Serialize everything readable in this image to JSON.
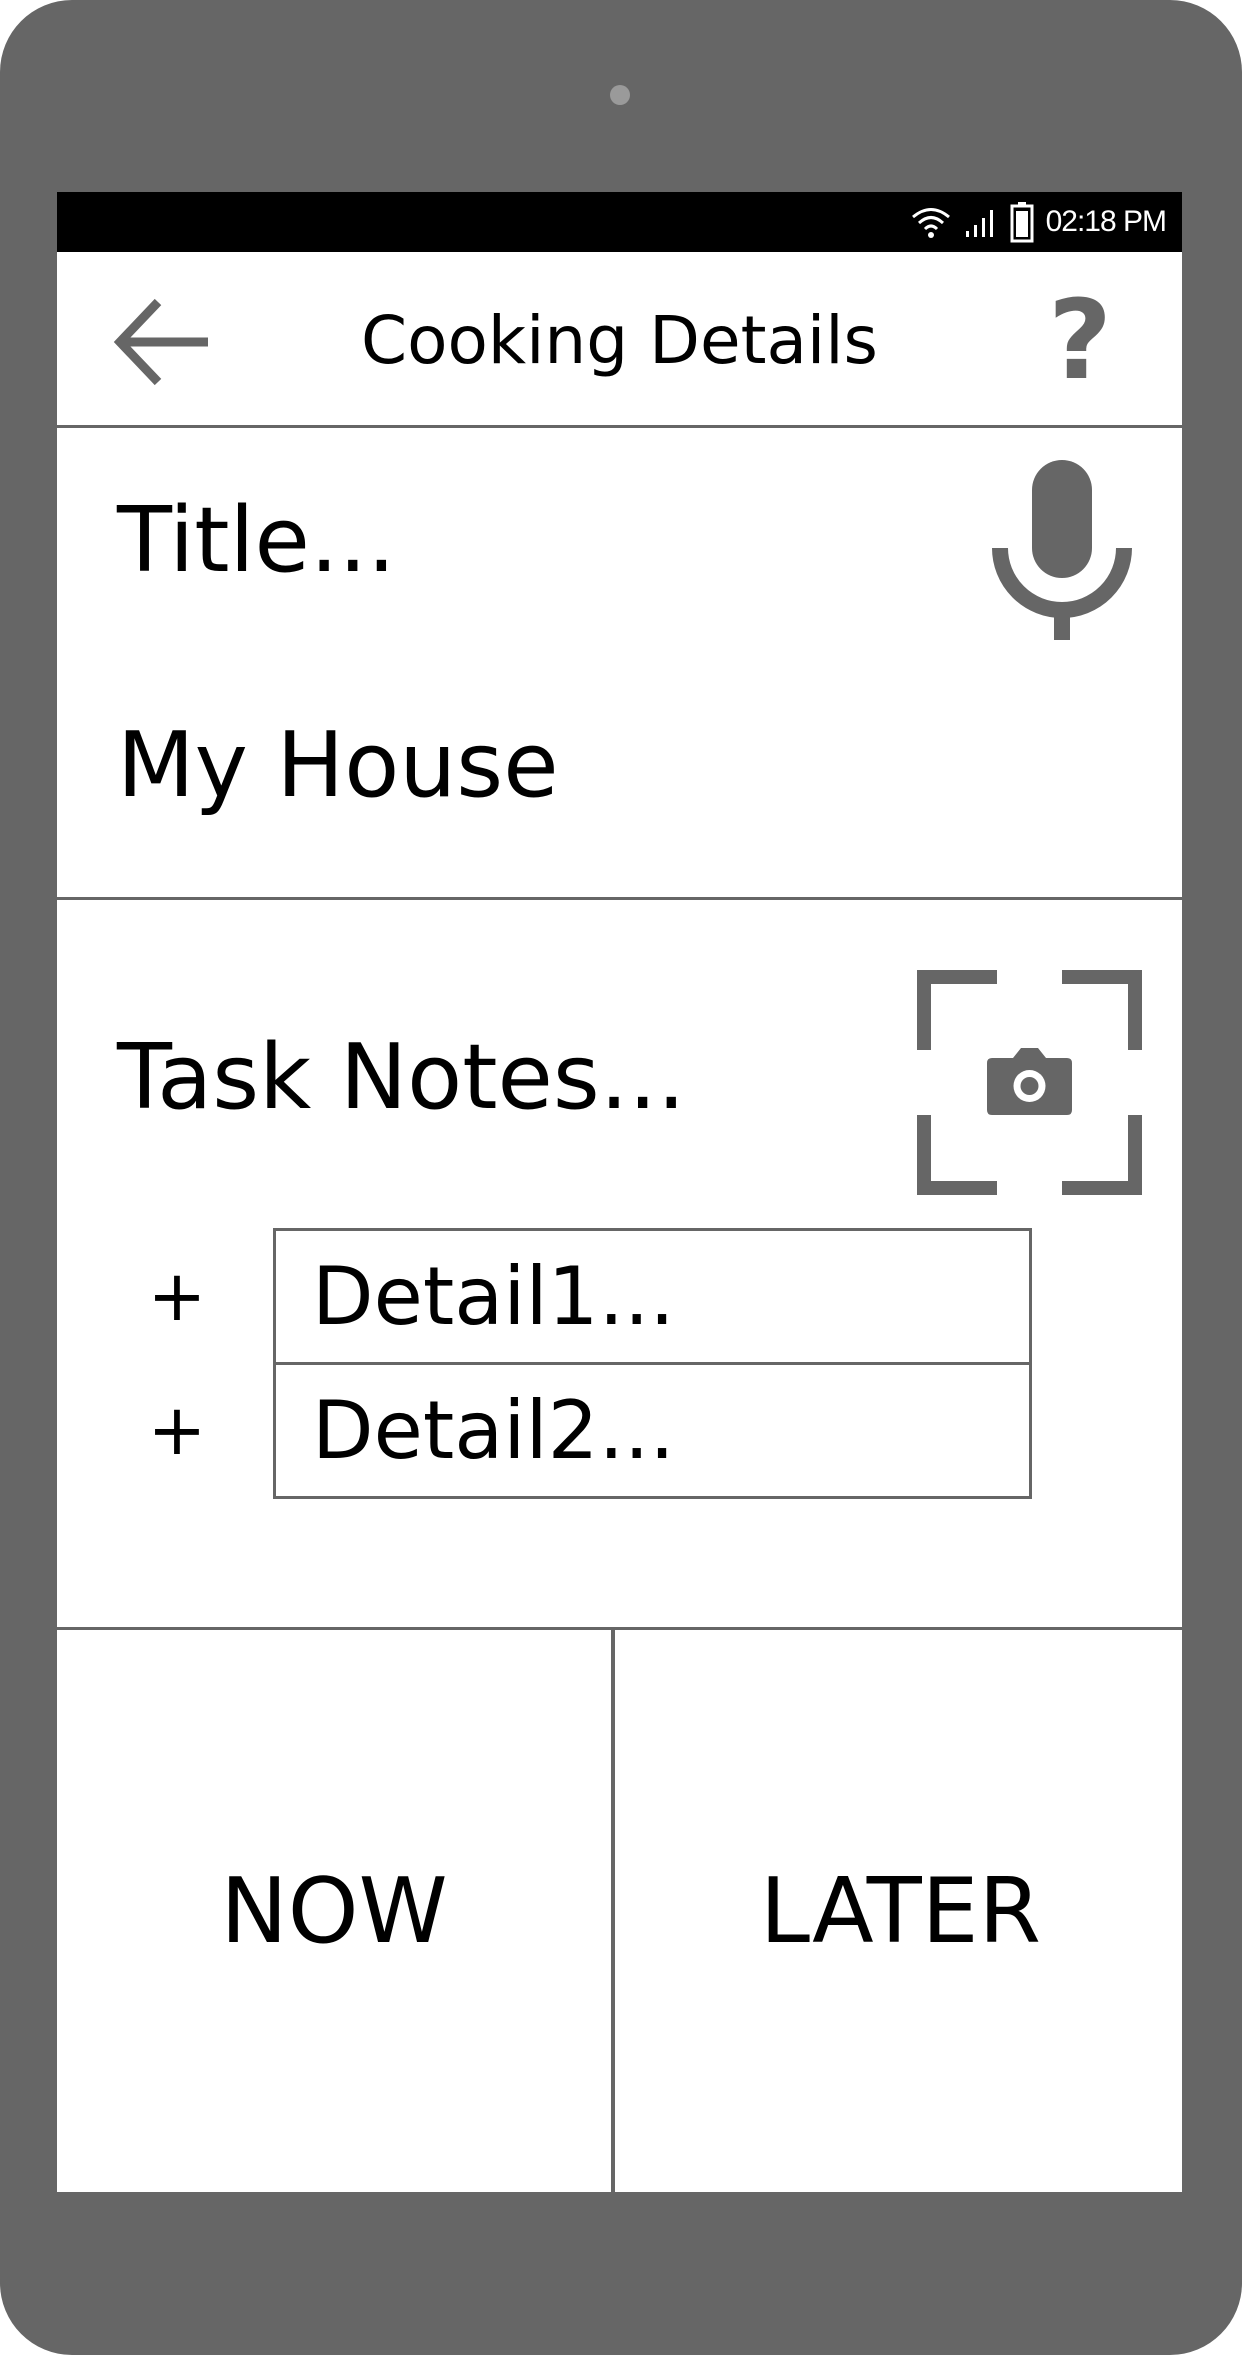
{
  "status_bar": {
    "time": "02:18 PM",
    "icons": [
      "wifi-icon",
      "signal-icon",
      "battery-icon"
    ]
  },
  "header": {
    "title": "Cooking Details",
    "back_icon": "arrow-left-icon",
    "help_label": "?"
  },
  "title_section": {
    "title_placeholder": "Title...",
    "mic_icon": "microphone-icon",
    "location_value": "My House"
  },
  "notes_section": {
    "label": "Task Notes...",
    "camera_icon": "camera-scan-icon",
    "details": [
      {
        "plus": "+",
        "placeholder": "Detail1..."
      },
      {
        "plus": "+",
        "placeholder": "Detail2..."
      }
    ]
  },
  "actions": {
    "now_label": "NOW",
    "later_label": "LATER"
  },
  "colors": {
    "frame": "#666666",
    "icon": "#666666",
    "status_bar": "#000000",
    "text": "#000000"
  }
}
